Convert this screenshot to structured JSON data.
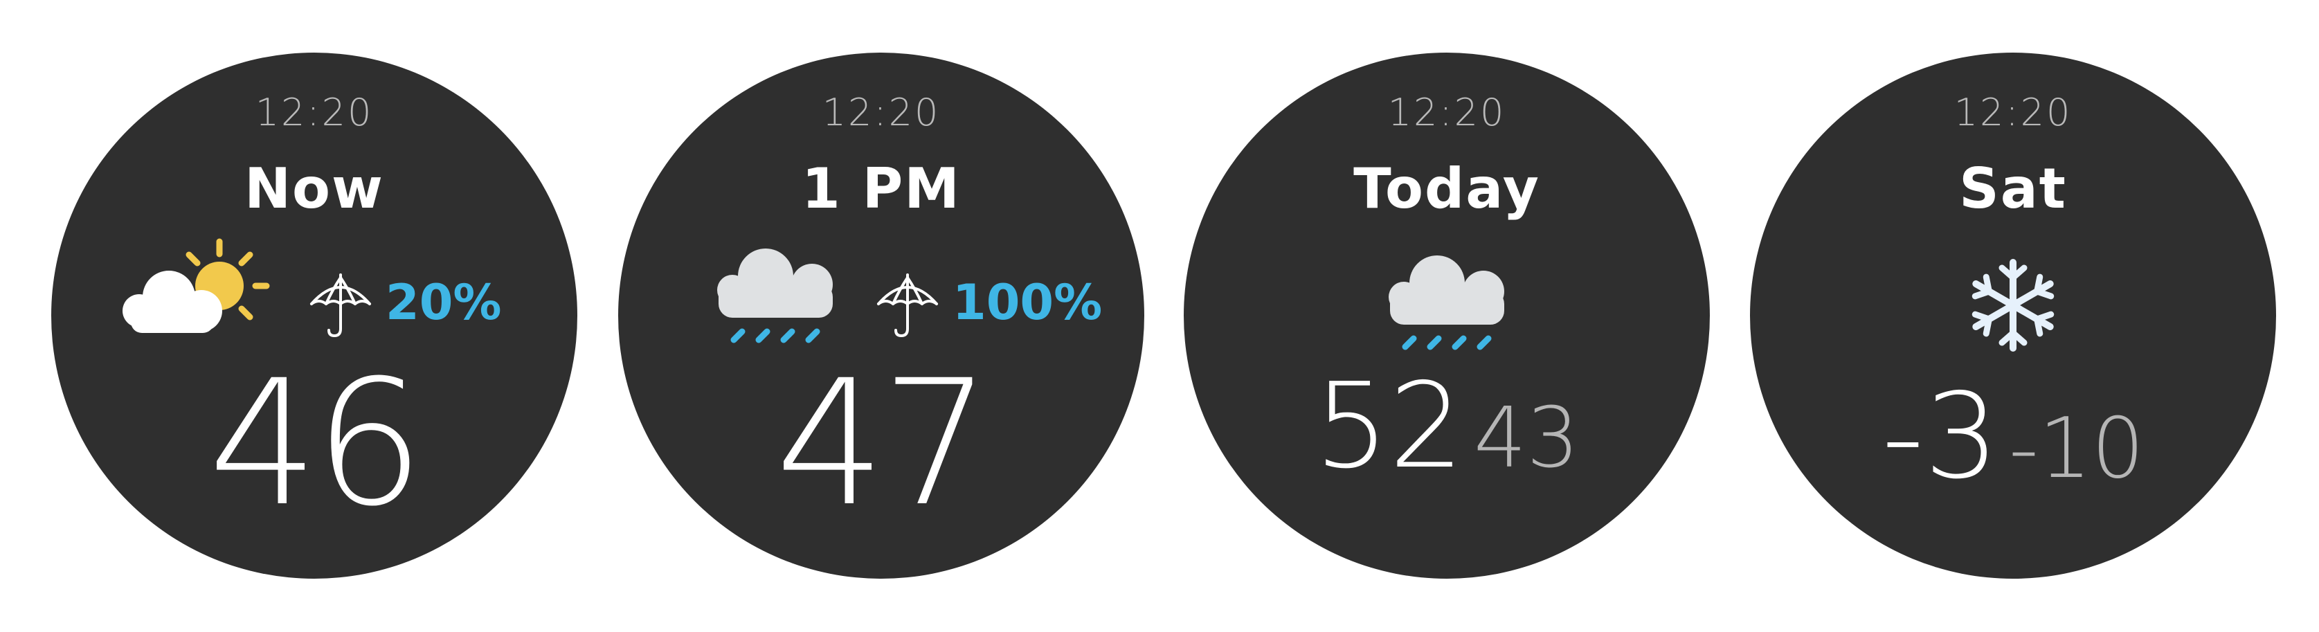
{
  "colors": {
    "face": "#2f2f2f",
    "accent_blue": "#3fb6e5",
    "sun": "#f2c94c",
    "cloud": "#ffffff",
    "cloud_rain": "#dfe1e3",
    "snow": "#e6f1fb"
  },
  "faces": [
    {
      "time": "12:20",
      "label": "Now",
      "icon": "partly-cloudy-icon",
      "precip_icon": "umbrella-icon",
      "precip": "20%",
      "temp": "46"
    },
    {
      "time": "12:20",
      "label": "1 PM",
      "icon": "rain-cloud-icon",
      "precip_icon": "umbrella-icon",
      "precip": "100%",
      "temp": "47"
    },
    {
      "time": "12:20",
      "label": "Today",
      "icon": "rain-cloud-icon",
      "high": "52",
      "low": "43"
    },
    {
      "time": "12:20",
      "label": "Sat",
      "icon": "snowflake-icon",
      "high": "-3",
      "low": "-10"
    }
  ]
}
